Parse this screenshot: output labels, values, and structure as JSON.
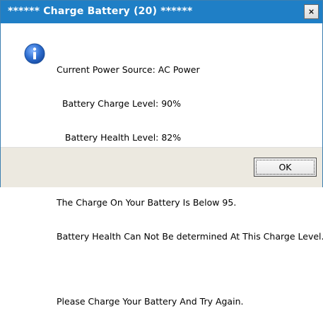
{
  "window": {
    "title": "****** Charge Battery (20) ******"
  },
  "message": {
    "icon": "info-icon",
    "power_source": "Current Power Source: AC Power",
    "charge_level": "  Battery Charge Level: 90%",
    "health_level": "   Battery Health Level: 82%",
    "below_notice": "The Charge On Your Battery Is Below 95.",
    "health_notice": "Battery Health Can Not Be determined At This Charge Level.",
    "instruction": "Please Charge Your Battery And Try Again."
  },
  "buttons": {
    "ok_label": "OK",
    "close_icon": "close-icon"
  },
  "colors": {
    "titlebar": "#1f7fc6",
    "footer": "#ece9e0",
    "info_icon": "#2f6fd0"
  }
}
